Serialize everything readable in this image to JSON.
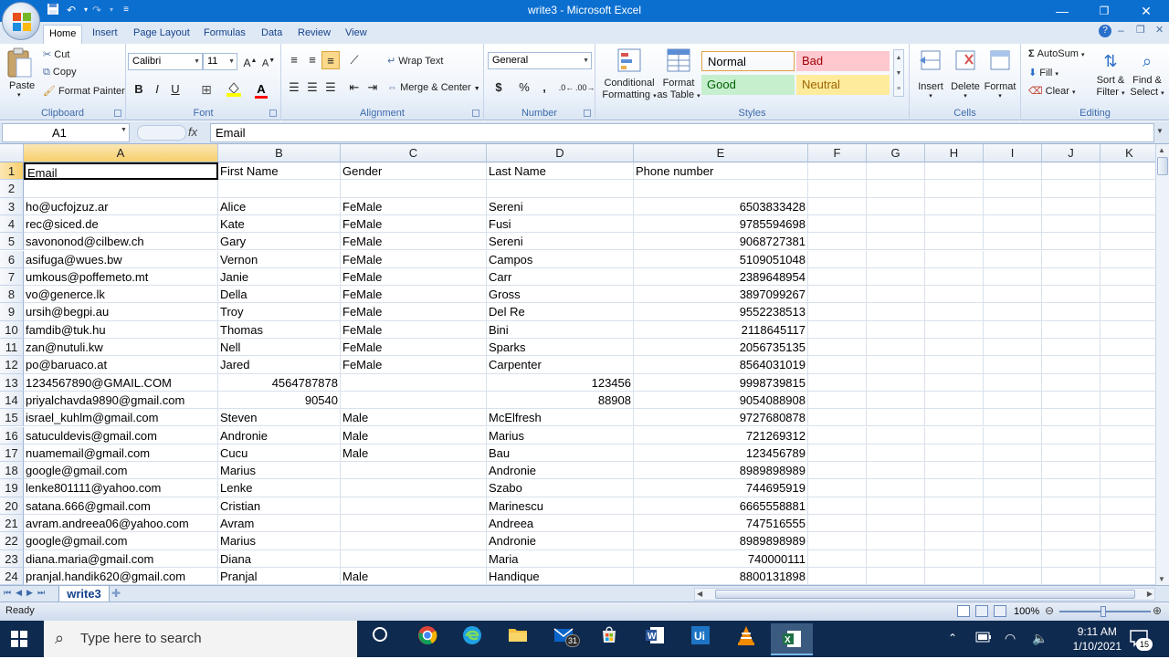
{
  "window": {
    "title": "write3 - Microsoft Excel",
    "minimize_icon": "minimize-icon",
    "maximize_icon": "restore-icon",
    "close_icon": "close-icon",
    "accent": "#0b6fd0"
  },
  "quick_access": [
    "save-icon",
    "undo-icon",
    "redo-icon",
    "customize-icon"
  ],
  "ribbon_tabs": [
    "Home",
    "Insert",
    "Page Layout",
    "Formulas",
    "Data",
    "Review",
    "View"
  ],
  "ribbon": {
    "clipboard": {
      "label": "Clipboard",
      "paste": "Paste",
      "cut": "Cut",
      "copy": "Copy",
      "format_painter": "Format Painter"
    },
    "font": {
      "label": "Font",
      "font_name": "Calibri",
      "font_size": "11",
      "bold": "B",
      "italic": "I",
      "underline": "U"
    },
    "alignment": {
      "label": "Alignment",
      "wrap_text": "Wrap Text",
      "merge_center": "Merge & Center"
    },
    "number": {
      "label": "Number",
      "format": "General",
      "currency": "$",
      "percent": "%",
      "comma": ","
    },
    "styles": {
      "label": "Styles",
      "conditional_formatting": [
        "Conditional",
        "Formatting"
      ],
      "format_as_table": [
        "Format",
        "as Table"
      ],
      "cells": [
        {
          "name": "Normal",
          "bg": "#ffffff",
          "color": "#000000"
        },
        {
          "name": "Bad",
          "bg": "#ffc7ce",
          "color": "#9c0006"
        },
        {
          "name": "Good",
          "bg": "#c6efce",
          "color": "#006100"
        },
        {
          "name": "Neutral",
          "bg": "#ffeb9c",
          "color": "#9c6500"
        }
      ]
    },
    "cells_group": {
      "label": "Cells",
      "insert": "Insert",
      "delete": "Delete",
      "format": "Format"
    },
    "editing": {
      "label": "Editing",
      "autosum": "AutoSum",
      "fill": "Fill",
      "clear": "Clear",
      "sort_filter": [
        "Sort &",
        "Filter"
      ],
      "find_select": [
        "Find &",
        "Select"
      ]
    }
  },
  "formula_bar": {
    "name_box": "A1",
    "fx": "fx",
    "content": "Email"
  },
  "columns": [
    "A",
    "B",
    "C",
    "D",
    "E",
    "F",
    "G",
    "H",
    "I",
    "J",
    "K"
  ],
  "rows": [
    {
      "n": "1",
      "A": "Email",
      "B": "First Name",
      "C": "Gender",
      "D": "Last Name",
      "E": "Phone number",
      "E_num": false
    },
    {
      "n": "2",
      "A": "",
      "B": "",
      "C": "",
      "D": "",
      "E": ""
    },
    {
      "n": "3",
      "A": "ho@ucfojzuz.ar",
      "B": "Alice",
      "C": "FeMale",
      "D": "Sereni",
      "E": "6503833428"
    },
    {
      "n": "4",
      "A": "rec@siced.de",
      "B": "Kate",
      "C": "FeMale",
      "D": "Fusi",
      "E": "9785594698"
    },
    {
      "n": "5",
      "A": "savononod@cilbew.ch",
      "B": "Gary",
      "C": "FeMale",
      "D": "Sereni",
      "E": "9068727381"
    },
    {
      "n": "6",
      "A": "asifuga@wues.bw",
      "B": "Vernon",
      "C": "FeMale",
      "D": "Campos",
      "E": "5109051048"
    },
    {
      "n": "7",
      "A": "umkous@poffemeto.mt",
      "B": "Janie",
      "C": "FeMale",
      "D": "Carr",
      "E": "2389648954"
    },
    {
      "n": "8",
      "A": "vo@generce.lk",
      "B": "Della",
      "C": "FeMale",
      "D": "Gross",
      "E": "3897099267"
    },
    {
      "n": "9",
      "A": "ursih@begpi.au",
      "B": "Troy",
      "C": "FeMale",
      "D": "Del Re",
      "E": "9552238513"
    },
    {
      "n": "10",
      "A": "famdib@tuk.hu",
      "B": "Thomas",
      "C": "FeMale",
      "D": "Bini",
      "E": "2118645117"
    },
    {
      "n": "11",
      "A": "zan@nutuli.kw",
      "B": "Nell",
      "C": "FeMale",
      "D": "Sparks",
      "E": "2056735135"
    },
    {
      "n": "12",
      "A": "po@baruaco.at",
      "B": "Jared",
      "C": "FeMale",
      "D": "Carpenter",
      "E": "8564031019"
    },
    {
      "n": "13",
      "A": "1234567890@GMAIL.COM",
      "B": "4564787878",
      "B_num": true,
      "C": "",
      "D": "123456",
      "D_num": true,
      "E": "9998739815"
    },
    {
      "n": "14",
      "A": "priyalchavda9890@gmail.com",
      "B": "90540",
      "B_num": true,
      "C": "",
      "D": "88908",
      "D_num": true,
      "E": "9054088908"
    },
    {
      "n": "15",
      "A": "israel_kuhlm@gmail.com",
      "B": "Steven",
      "C": "Male",
      "D": "McElfresh",
      "E": "9727680878"
    },
    {
      "n": "16",
      "A": "satuculdevis@gmail.com",
      "B": "Andronie",
      "C": "Male",
      "D": "Marius",
      "E": "721269312"
    },
    {
      "n": "17",
      "A": "nuamemail@gmail.com",
      "B": "Cucu",
      "C": "Male",
      "D": "Bau",
      "E": "123456789"
    },
    {
      "n": "18",
      "A": "google@gmail.com",
      "B": "Marius",
      "C": "",
      "D": "Andronie",
      "E": "8989898989"
    },
    {
      "n": "19",
      "A": "lenke801111@yahoo.com",
      "B": "Lenke",
      "C": "",
      "D": "Szabo",
      "E": "744695919"
    },
    {
      "n": "20",
      "A": "satana.666@gmail.com",
      "B": "Cristian",
      "C": "",
      "D": "Marinescu",
      "E": "6665558881"
    },
    {
      "n": "21",
      "A": "avram.andreea06@yahoo.com",
      "B": "Avram",
      "C": "",
      "D": "Andreea",
      "E": "747516555"
    },
    {
      "n": "22",
      "A": "google@gmail.com",
      "B": "Marius",
      "C": "",
      "D": "Andronie",
      "E": "8989898989"
    },
    {
      "n": "23",
      "A": "diana.maria@gmail.com",
      "B": "Diana",
      "C": "",
      "D": "Maria",
      "E": "740000111"
    },
    {
      "n": "24",
      "A": "pranjal.handik620@gmail.com",
      "B": "Pranjal",
      "C": "Male",
      "D": "Handique",
      "E": "8800131898"
    }
  ],
  "sheet_tab": "write3",
  "status": {
    "ready": "Ready",
    "zoom": "100%"
  },
  "taskbar": {
    "search_placeholder": "Type here to search",
    "time": "9:11 AM",
    "date": "1/10/2021",
    "mail_badge": "31",
    "notif_badge": "15"
  }
}
